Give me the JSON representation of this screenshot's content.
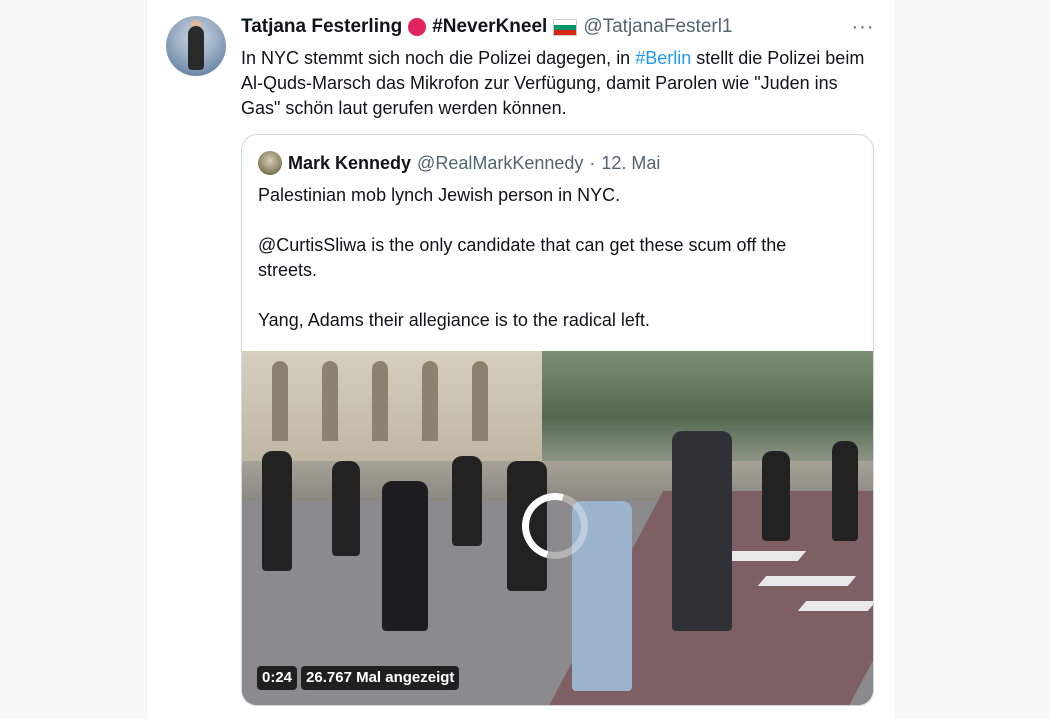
{
  "tweet": {
    "author_name": "Tatjana Festerling",
    "author_tag": "#NeverKneel",
    "author_handle": "@TatjanaFesterl1",
    "more_icon": "···",
    "text_part1": "In NYC stemmt sich noch die Polizei dagegen, in ",
    "hashtag": "#Berlin",
    "text_part2": " stellt die Polizei beim Al-Quds-Marsch das Mikrofon zur Verfügung, damit Parolen wie \"Juden ins Gas\" schön laut gerufen werden können."
  },
  "quoted": {
    "author_name": "Mark Kennedy",
    "author_handle": "@RealMarkKennedy",
    "separator": "·",
    "date": "12. Mai",
    "paragraphs": [
      "Palestinian mob lynch Jewish person in NYC.",
      "@CurtisSliwa is the only candidate that can get these scum off the streets.",
      "Yang, Adams their allegiance is to the radical left."
    ],
    "video": {
      "duration": "0:24",
      "views": "26.767 Mal angezeigt"
    }
  },
  "colors": {
    "link": "#1d9bf0",
    "text": "#0f1419",
    "secondary": "#536471",
    "emoji_red": "#e0245e",
    "flag_bg": [
      "#ffffff",
      "#00966e",
      "#d62612"
    ]
  },
  "icons": [
    "red-circle-emoji-icon",
    "bulgaria-flag-icon",
    "more-options-icon",
    "loading-spinner-icon"
  ]
}
